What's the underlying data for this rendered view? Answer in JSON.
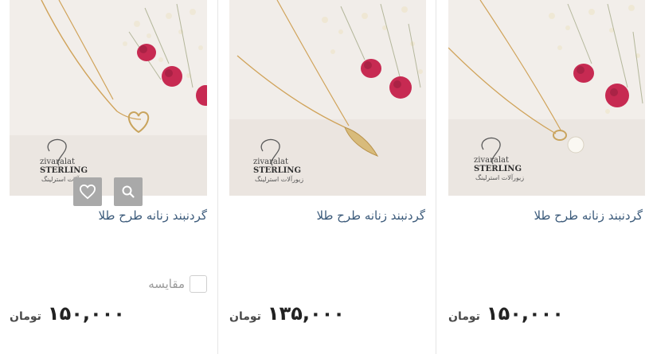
{
  "products": [
    {
      "title": "گردنبند زنانه طرح طلا",
      "price": "۱۵۰,۰۰۰",
      "currency": "تومان",
      "watermark": {
        "line1": "zivaralat",
        "line2": "STERLING",
        "line3": "زیورآلات استرلینگ"
      },
      "pendant": "heart"
    },
    {
      "title": "گردنبند زنانه طرح طلا",
      "price": "۱۳۵,۰۰۰",
      "currency": "تومان",
      "watermark": {
        "line1": "zivaralat",
        "line2": "STERLING",
        "line3": "زیورآلات استرلینگ"
      },
      "pendant": "leaf"
    },
    {
      "title": "گردنبند زنانه طرح طلا",
      "price": "۱۵۰,۰۰۰",
      "currency": "تومان",
      "watermark": {
        "line1": "zivaralat",
        "line2": "STERLING",
        "line3": "زیورآلات استرلینگ"
      },
      "pendant": "pearl"
    }
  ],
  "hover_actions": {
    "quick_view_icon": "search-icon",
    "wishlist_icon": "heart-icon"
  },
  "compare_label": "مقایسه",
  "colors": {
    "title": "#3b5a7a",
    "button": "#a9a9a9",
    "flower": "#c72a52"
  }
}
